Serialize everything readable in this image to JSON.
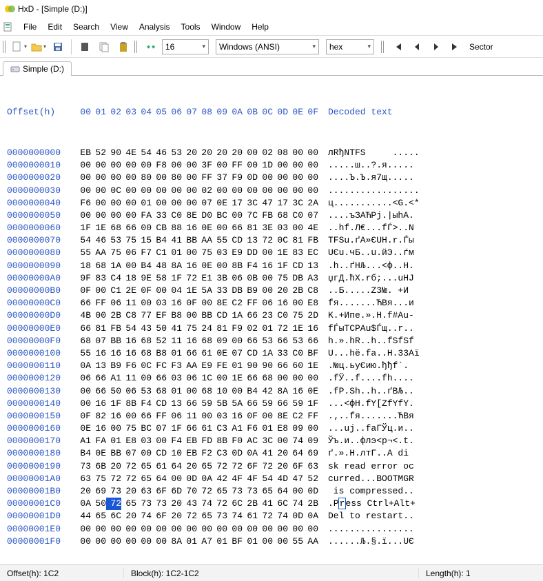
{
  "title": "HxD - [Simple (D:)]",
  "menu": [
    "File",
    "Edit",
    "Search",
    "View",
    "Analysis",
    "Tools",
    "Window",
    "Help"
  ],
  "toolbar": {
    "bytes_per_row": "16",
    "encoding": "Windows (ANSI)",
    "base": "hex",
    "nav_label": "Sector"
  },
  "tab": {
    "label": "Simple (D:)"
  },
  "header": {
    "offset_label": "Offset(h)",
    "cols": [
      "00",
      "01",
      "02",
      "03",
      "04",
      "05",
      "06",
      "07",
      "08",
      "09",
      "0A",
      "0B",
      "0C",
      "0D",
      "0E",
      "0F"
    ],
    "decoded_label": "Decoded text"
  },
  "selection": {
    "row": 28,
    "col": 2
  },
  "rows": [
    {
      "addr": "0000000000",
      "hex": [
        "EB",
        "52",
        "90",
        "4E",
        "54",
        "46",
        "53",
        "20",
        "20",
        "20",
        "20",
        "00",
        "02",
        "08",
        "00",
        "00"
      ],
      "dec": "лRђNTFS     ....."
    },
    {
      "addr": "0000000010",
      "hex": [
        "00",
        "00",
        "00",
        "00",
        "00",
        "F8",
        "00",
        "00",
        "3F",
        "00",
        "FF",
        "00",
        "1D",
        "00",
        "00",
        "00"
      ],
      "dec": ".....ш..?.я....."
    },
    {
      "addr": "0000000020",
      "hex": [
        "00",
        "00",
        "00",
        "00",
        "80",
        "00",
        "80",
        "00",
        "FF",
        "37",
        "F9",
        "0D",
        "00",
        "00",
        "00",
        "00"
      ],
      "dec": "....Ъ.Ъ.я7щ....."
    },
    {
      "addr": "0000000030",
      "hex": [
        "00",
        "00",
        "0C",
        "00",
        "00",
        "00",
        "00",
        "00",
        "02",
        "00",
        "00",
        "00",
        "00",
        "00",
        "00",
        "00"
      ],
      "dec": "................."
    },
    {
      "addr": "0000000040",
      "hex": [
        "F6",
        "00",
        "00",
        "00",
        "01",
        "00",
        "00",
        "00",
        "07",
        "0E",
        "17",
        "3C",
        "47",
        "17",
        "3C",
        "2A"
      ],
      "dec": "ц...........<G.<*"
    },
    {
      "addr": "0000000050",
      "hex": [
        "00",
        "00",
        "00",
        "00",
        "FA",
        "33",
        "C0",
        "8E",
        "D0",
        "BC",
        "00",
        "7C",
        "FB",
        "68",
        "C0",
        "07"
      ],
      "dec": "....ъЗАЋРј.|ыhА."
    },
    {
      "addr": "0000000060",
      "hex": [
        "1F",
        "1E",
        "68",
        "66",
        "00",
        "CB",
        "88",
        "16",
        "0E",
        "00",
        "66",
        "81",
        "3E",
        "03",
        "00",
        "4E"
      ],
      "dec": "..hf.Л€...fЃ>..N"
    },
    {
      "addr": "0000000070",
      "hex": [
        "54",
        "46",
        "53",
        "75",
        "15",
        "B4",
        "41",
        "BB",
        "AA",
        "55",
        "CD",
        "13",
        "72",
        "0C",
        "81",
        "FB"
      ],
      "dec": "TFSu.ґA»ЄUH.r.Ѓы"
    },
    {
      "addr": "0000000080",
      "hex": [
        "55",
        "AA",
        "75",
        "06",
        "F7",
        "C1",
        "01",
        "00",
        "75",
        "03",
        "E9",
        "DD",
        "00",
        "1E",
        "83",
        "EC"
      ],
      "dec": "UЄu.чБ..u.йЭ..ѓм"
    },
    {
      "addr": "0000000090",
      "hex": [
        "18",
        "68",
        "1A",
        "00",
        "B4",
        "48",
        "8A",
        "16",
        "0E",
        "00",
        "8B",
        "F4",
        "16",
        "1F",
        "CD",
        "13"
      ],
      "dec": ".h..ґHЉ...<ф..Н."
    },
    {
      "addr": "00000000A0",
      "hex": [
        "9F",
        "83",
        "C4",
        "18",
        "9E",
        "58",
        "1F",
        "72",
        "E1",
        "3B",
        "06",
        "0B",
        "00",
        "75",
        "DB",
        "A3"
      ],
      "dec": "џгД.ћX.rб;...uНJ"
    },
    {
      "addr": "00000000B0",
      "hex": [
        "0F",
        "00",
        "C1",
        "2E",
        "0F",
        "00",
        "04",
        "1E",
        "5A",
        "33",
        "DB",
        "B9",
        "00",
        "20",
        "2B",
        "C8"
      ],
      "dec": "..Б.....Z3№. +И"
    },
    {
      "addr": "00000000C0",
      "hex": [
        "66",
        "FF",
        "06",
        "11",
        "00",
        "03",
        "16",
        "0F",
        "00",
        "8E",
        "C2",
        "FF",
        "06",
        "16",
        "00",
        "E8"
      ],
      "dec": "fя.......ЋВя...и"
    },
    {
      "addr": "00000000D0",
      "hex": [
        "4B",
        "00",
        "2B",
        "C8",
        "77",
        "EF",
        "B8",
        "00",
        "BB",
        "CD",
        "1A",
        "66",
        "23",
        "C0",
        "75",
        "2D"
      ],
      "dec": "K.+Ипе.».Н.f#Аu-"
    },
    {
      "addr": "00000000E0",
      "hex": [
        "66",
        "81",
        "FB",
        "54",
        "43",
        "50",
        "41",
        "75",
        "24",
        "81",
        "F9",
        "02",
        "01",
        "72",
        "1E",
        "16"
      ],
      "dec": "fЃыTCPAu$Ѓщ..r.."
    },
    {
      "addr": "00000000F0",
      "hex": [
        "68",
        "07",
        "BB",
        "16",
        "68",
        "52",
        "11",
        "16",
        "68",
        "09",
        "00",
        "66",
        "53",
        "66",
        "53",
        "66"
      ],
      "dec": "h.».hR..h..fSfSf"
    },
    {
      "addr": "0000000100",
      "hex": [
        "55",
        "16",
        "16",
        "16",
        "68",
        "B8",
        "01",
        "66",
        "61",
        "0E",
        "07",
        "CD",
        "1A",
        "33",
        "C0",
        "BF"
      ],
      "dec": "U...hё.fa..Н.33Аї"
    },
    {
      "addr": "0000000110",
      "hex": [
        "0A",
        "13",
        "B9",
        "F6",
        "0C",
        "FC",
        "F3",
        "AA",
        "E9",
        "FE",
        "01",
        "90",
        "90",
        "66",
        "60",
        "1E"
      ],
      "dec": ".№ц.ьуЄию.ђђf`."
    },
    {
      "addr": "0000000120",
      "hex": [
        "06",
        "66",
        "A1",
        "11",
        "00",
        "66",
        "03",
        "06",
        "1C",
        "00",
        "1E",
        "66",
        "68",
        "00",
        "00",
        "00"
      ],
      "dec": ".fЎ..f....fh...."
    },
    {
      "addr": "0000000130",
      "hex": [
        "00",
        "66",
        "50",
        "06",
        "53",
        "68",
        "01",
        "00",
        "68",
        "10",
        "00",
        "B4",
        "42",
        "8A",
        "16",
        "0E"
      ],
      "dec": ".fP.Sh..h..ґBЉ.."
    },
    {
      "addr": "0000000140",
      "hex": [
        "00",
        "16",
        "1F",
        "8B",
        "F4",
        "CD",
        "13",
        "66",
        "59",
        "5B",
        "5A",
        "66",
        "59",
        "66",
        "59",
        "1F"
      ],
      "dec": "...<фН.fY[ZfYfY."
    },
    {
      "addr": "0000000150",
      "hex": [
        "0F",
        "82",
        "16",
        "00",
        "66",
        "FF",
        "06",
        "11",
        "00",
        "03",
        "16",
        "0F",
        "00",
        "8E",
        "C2",
        "FF"
      ],
      "dec": ".‚..fя.......ЋВя"
    },
    {
      "addr": "0000000160",
      "hex": [
        "0E",
        "16",
        "00",
        "75",
        "BC",
        "07",
        "1F",
        "66",
        "61",
        "C3",
        "A1",
        "F6",
        "01",
        "E8",
        "09",
        "00"
      ],
      "dec": "...uј..faГЎц.и.."
    },
    {
      "addr": "0000000170",
      "hex": [
        "A1",
        "FA",
        "01",
        "E8",
        "03",
        "00",
        "F4",
        "EB",
        "FD",
        "8B",
        "F0",
        "AC",
        "3C",
        "00",
        "74",
        "09"
      ],
      "dec": "Ўъ.и..флэ<р¬<.t."
    },
    {
      "addr": "0000000180",
      "hex": [
        "B4",
        "0E",
        "BB",
        "07",
        "00",
        "CD",
        "10",
        "EB",
        "F2",
        "C3",
        "0D",
        "0A",
        "41",
        "20",
        "64",
        "69"
      ],
      "dec": "ґ.».Н.лтГ..A di"
    },
    {
      "addr": "0000000190",
      "hex": [
        "73",
        "6B",
        "20",
        "72",
        "65",
        "61",
        "64",
        "20",
        "65",
        "72",
        "72",
        "6F",
        "72",
        "20",
        "6F",
        "63"
      ],
      "dec": "sk read error oc"
    },
    {
      "addr": "00000001A0",
      "hex": [
        "63",
        "75",
        "72",
        "72",
        "65",
        "64",
        "00",
        "0D",
        "0A",
        "42",
        "4F",
        "4F",
        "54",
        "4D",
        "47",
        "52"
      ],
      "dec": "curred...BOOTMGR"
    },
    {
      "addr": "00000001B0",
      "hex": [
        "20",
        "69",
        "73",
        "20",
        "63",
        "6F",
        "6D",
        "70",
        "72",
        "65",
        "73",
        "73",
        "65",
        "64",
        "00",
        "0D"
      ],
      "dec": " is compressed.."
    },
    {
      "addr": "00000001C0",
      "hex": [
        "0A",
        "50",
        "72",
        "65",
        "73",
        "73",
        "20",
        "43",
        "74",
        "72",
        "6C",
        "2B",
        "41",
        "6C",
        "74",
        "2B"
      ],
      "dec": ".Press Ctrl+Alt+",
      "selDec": 2
    },
    {
      "addr": "00000001D0",
      "hex": [
        "44",
        "65",
        "6C",
        "20",
        "74",
        "6F",
        "20",
        "72",
        "65",
        "73",
        "74",
        "61",
        "72",
        "74",
        "0D",
        "0A"
      ],
      "dec": "Del to restart.."
    },
    {
      "addr": "00000001E0",
      "hex": [
        "00",
        "00",
        "00",
        "00",
        "00",
        "00",
        "00",
        "00",
        "00",
        "00",
        "00",
        "00",
        "00",
        "00",
        "00",
        "00"
      ],
      "dec": "................"
    },
    {
      "addr": "00000001F0",
      "hex": [
        "00",
        "00",
        "00",
        "00",
        "00",
        "00",
        "8A",
        "01",
        "A7",
        "01",
        "BF",
        "01",
        "00",
        "00",
        "55",
        "AA"
      ],
      "dec": "......Љ.§.ї...UЄ"
    }
  ],
  "status": {
    "offset": "Offset(h): 1C2",
    "block": "Block(h): 1C2-1C2",
    "length": "Length(h): 1"
  }
}
